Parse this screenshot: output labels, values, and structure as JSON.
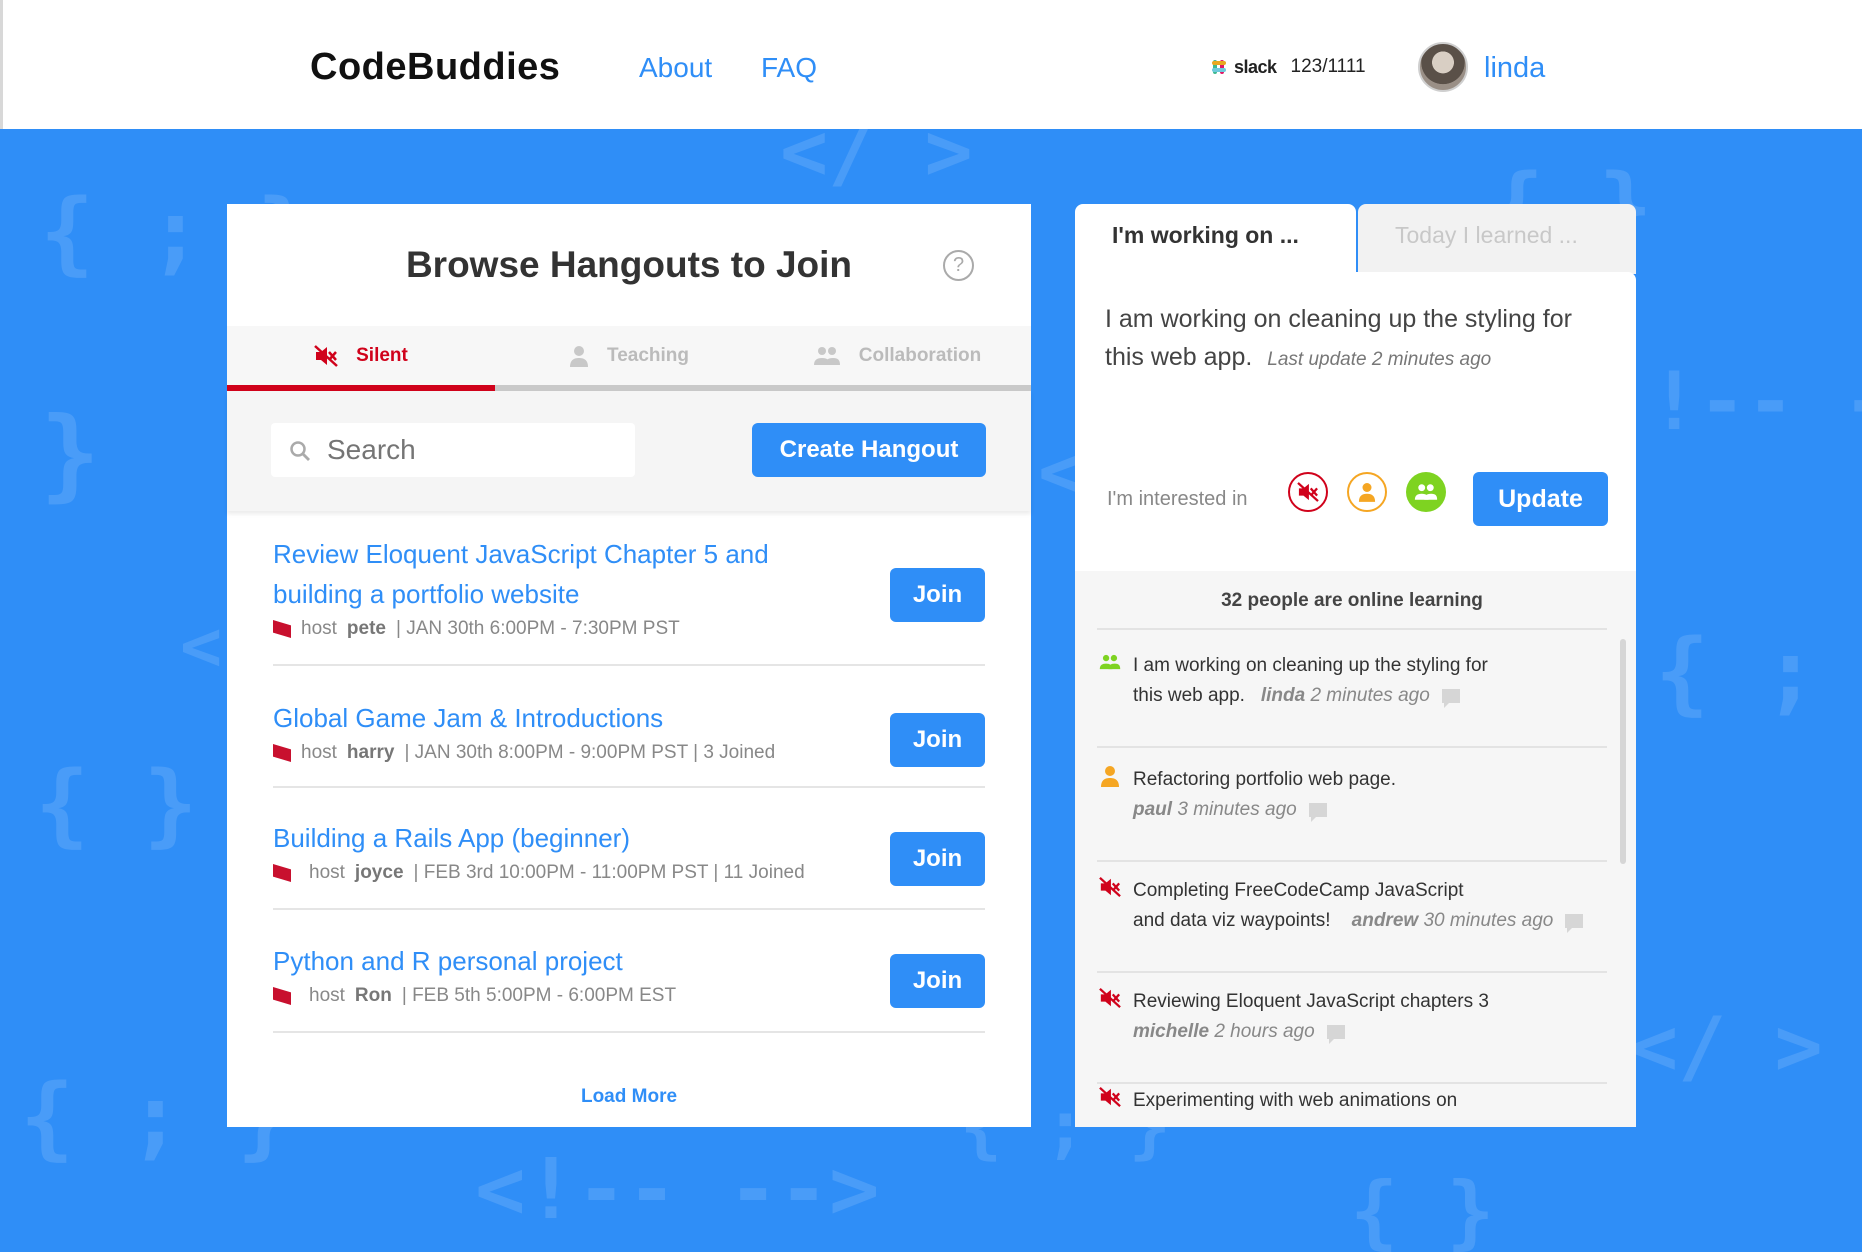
{
  "header": {
    "logo": "CodeBuddies",
    "nav": [
      "About",
      "FAQ"
    ],
    "slack_label": "slack",
    "slack_count": "123/1111",
    "username": "linda"
  },
  "background_glyphs": [
    "{ ; }",
    "</ >",
    "{ }",
    "}",
    "<",
    "{ ; }",
    "<!-- -->",
    "{ }",
    "!-- --",
    "{ ; }",
    "</ >",
    "{ ; }",
    "{ }",
    "<"
  ],
  "browse": {
    "title": "Browse Hangouts to Join",
    "help_icon": "?",
    "tabs": [
      {
        "label": "Silent",
        "icon": "muted-speaker-icon",
        "active": true
      },
      {
        "label": "Teaching",
        "icon": "person-icon",
        "active": false
      },
      {
        "label": "Collaboration",
        "icon": "group-icon",
        "active": false
      }
    ],
    "search_placeholder": "Search",
    "create_label": "Create Hangout",
    "hangouts": [
      {
        "title": "Review Eloquent JavaScript Chapter 5 and building a portfolio website",
        "host_prefix": "host",
        "host": "pete",
        "meta": "| JAN 30th 6:00PM - 7:30PM PST",
        "join": "Join"
      },
      {
        "title": "Global Game Jam & Introductions",
        "host_prefix": "host",
        "host": "harry",
        "meta": "| JAN 30th 8:00PM - 9:00PM PST | 3 Joined",
        "join": "Join"
      },
      {
        "title": "Building a Rails App (beginner)",
        "host_prefix": "host",
        "host": "joyce",
        "meta": "| FEB 3rd 10:00PM - 11:00PM PST | 11 Joined",
        "join": "Join"
      },
      {
        "title": "Python and R personal project",
        "host_prefix": "host",
        "host": "Ron",
        "meta": "| FEB 5th 5:00PM - 6:00PM EST",
        "join": "Join"
      }
    ],
    "load_more": "Load More"
  },
  "status": {
    "tab_working": "I'm working on ...",
    "tab_learned": "Today I learned ...",
    "text": "I am working on cleaning up the styling for this web app.",
    "last_update": "Last update 2 minutes ago",
    "interested_label": "I'm interested in",
    "interest_icons": [
      "muted-speaker-icon",
      "person-icon",
      "group-icon"
    ],
    "update_label": "Update"
  },
  "feed": {
    "header": "32 people are online learning",
    "items": [
      {
        "icon": "group-icon",
        "color": "#7ed321",
        "line1": "I am working on cleaning up the styling for",
        "line2": "this web app.",
        "who": "linda",
        "when": "2 minutes ago"
      },
      {
        "icon": "person-icon",
        "color": "#f5a623",
        "line1": "Refactoring portfolio web page.",
        "line2": "",
        "who": "paul",
        "when": "3 minutes ago"
      },
      {
        "icon": "muted-speaker-icon",
        "color": "#d0021b",
        "line1": "Completing FreeCodeCamp JavaScript",
        "line2": "and data viz waypoints!",
        "who": "andrew",
        "when": "30 minutes ago"
      },
      {
        "icon": "muted-speaker-icon",
        "color": "#d0021b",
        "line1": "Reviewing Eloquent JavaScript chapters 3",
        "line2": "",
        "who": "michelle",
        "when": "2 hours ago"
      },
      {
        "icon": "muted-speaker-icon",
        "color": "#d0021b",
        "line1": "Experimenting with web animations on",
        "line2": "",
        "who": "",
        "when": ""
      }
    ]
  },
  "colors": {
    "accent": "#2f8ef7",
    "silent": "#d0021b",
    "teaching": "#f5a623",
    "collab": "#7ed321"
  }
}
